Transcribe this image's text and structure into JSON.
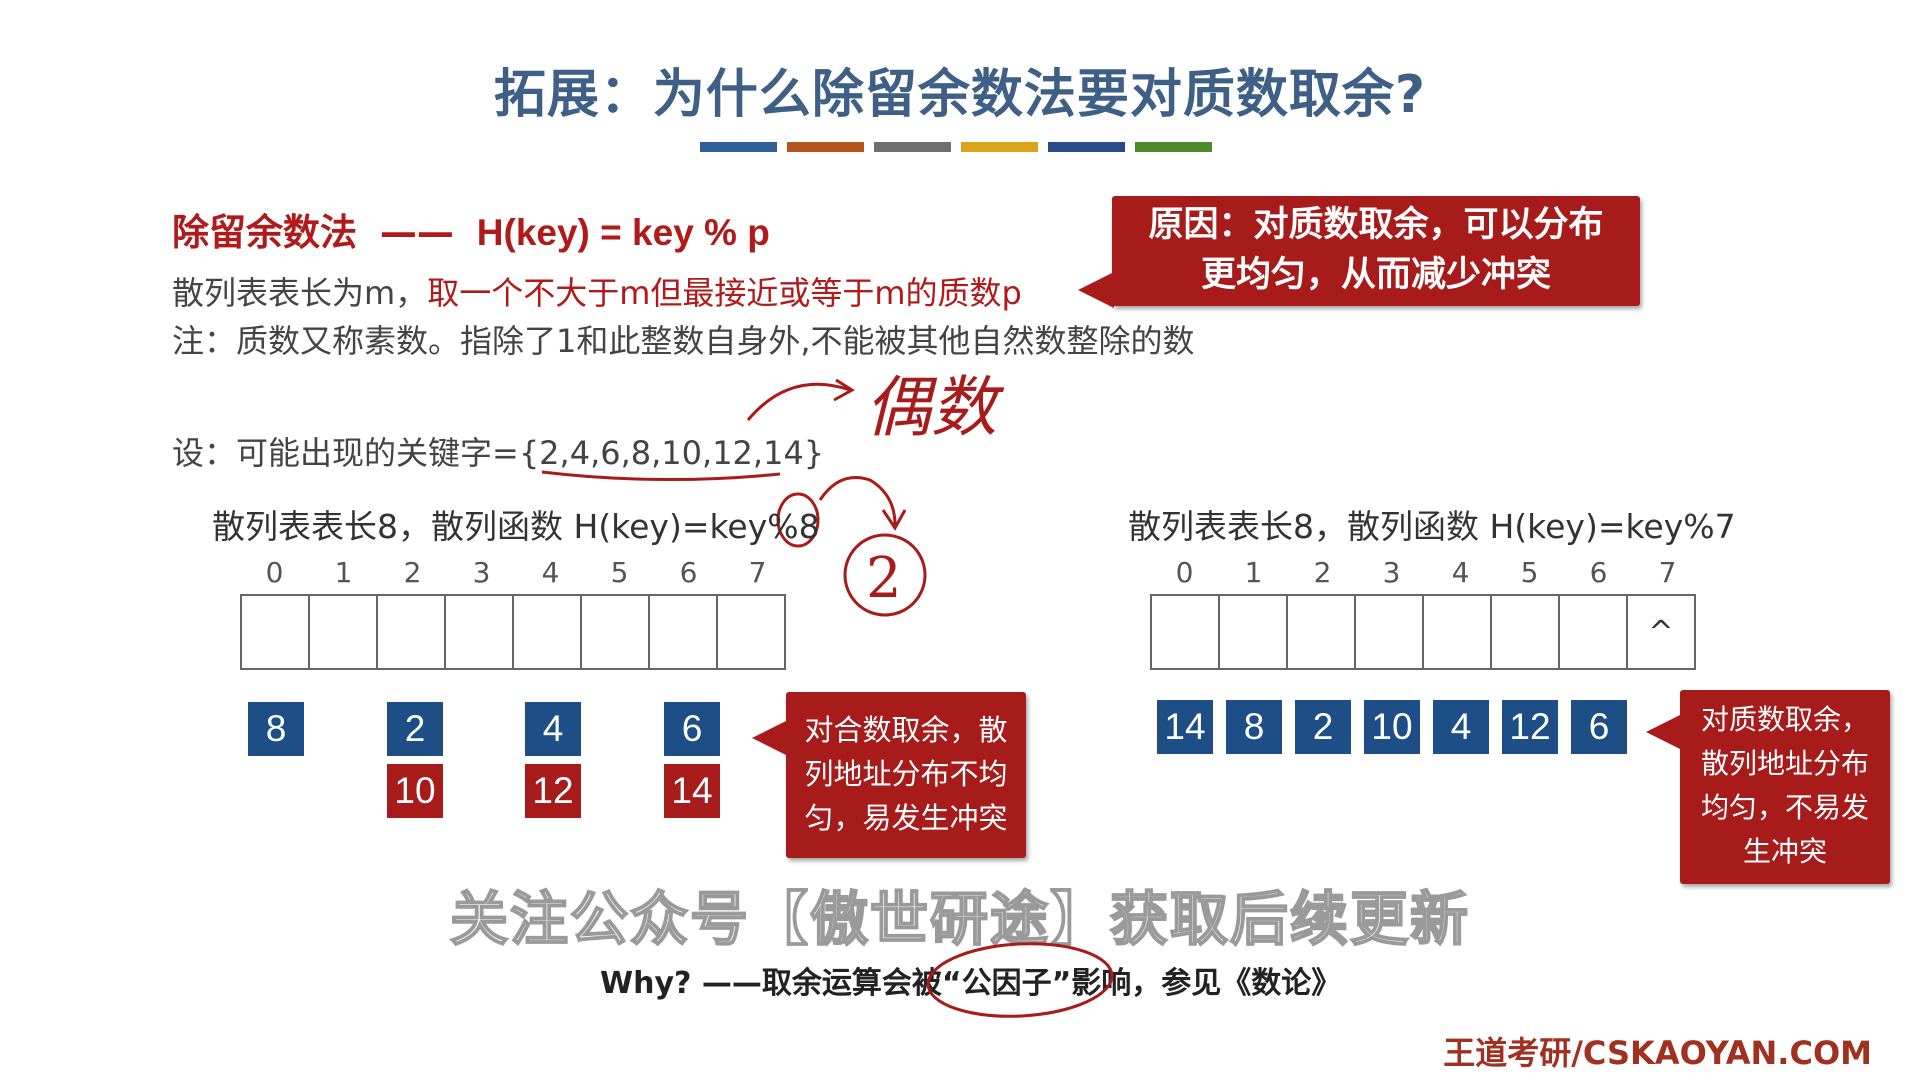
{
  "title": "拓展：为什么除留余数法要对质数取余?",
  "color_bars": [
    "#2f5f96",
    "#b5551e",
    "#6f6f6f",
    "#d8a418",
    "#2a4a8a",
    "#4d8a2a"
  ],
  "method": {
    "name": "除留余数法",
    "dash": "——",
    "formula": "H(key) = key % p"
  },
  "line1": {
    "prefix": "散列表表长为m，",
    "highlight": "取一个不大于m但最接近或等于m的质数p"
  },
  "line2": "注：质数又称素数。指除了1和此整数自身外,不能被其他自然数整除的数",
  "reason_callout": {
    "line1": "原因：对质数取余，可以分布",
    "line2": "更均匀，从而减少冲突"
  },
  "keys_line": "设：可能出现的关键字={2,4,6,8,10,12,14}",
  "handwriting": {
    "even": "偶数",
    "two": "2"
  },
  "left_table": {
    "label": "散列表表长8，散列函数 H(key)=key%8",
    "indices": [
      "0",
      "1",
      "2",
      "3",
      "4",
      "5",
      "6",
      "7"
    ],
    "cells": [
      "",
      "",
      "",
      "",
      "",
      "",
      "",
      ""
    ],
    "row1": [
      "8",
      "2",
      "4",
      "6"
    ],
    "row2": [
      "10",
      "12",
      "14"
    ]
  },
  "left_callout": {
    "line1": "对合数取余，散",
    "line2": "列地址分布不均",
    "line3": "匀，易发生冲突"
  },
  "right_table": {
    "label": "散列表表长8，散列函数 H(key)=key%7",
    "indices": [
      "0",
      "1",
      "2",
      "3",
      "4",
      "5",
      "6",
      "7"
    ],
    "cells": [
      "",
      "",
      "",
      "",
      "",
      "",
      "",
      "^"
    ],
    "row1": [
      "14",
      "8",
      "2",
      "10",
      "4",
      "12",
      "6"
    ]
  },
  "right_callout": {
    "line1": "对质数取余，",
    "line2": "散列地址分布",
    "line3": "均匀，不易发",
    "line4": "生冲突"
  },
  "watermark": "关注公众号【傲世研途】获取后续更新",
  "why_line": "Why? ——取余运算会被“公因子”影响，参见《数论》",
  "brand": "王道考研/CSKAOYAN.COM"
}
